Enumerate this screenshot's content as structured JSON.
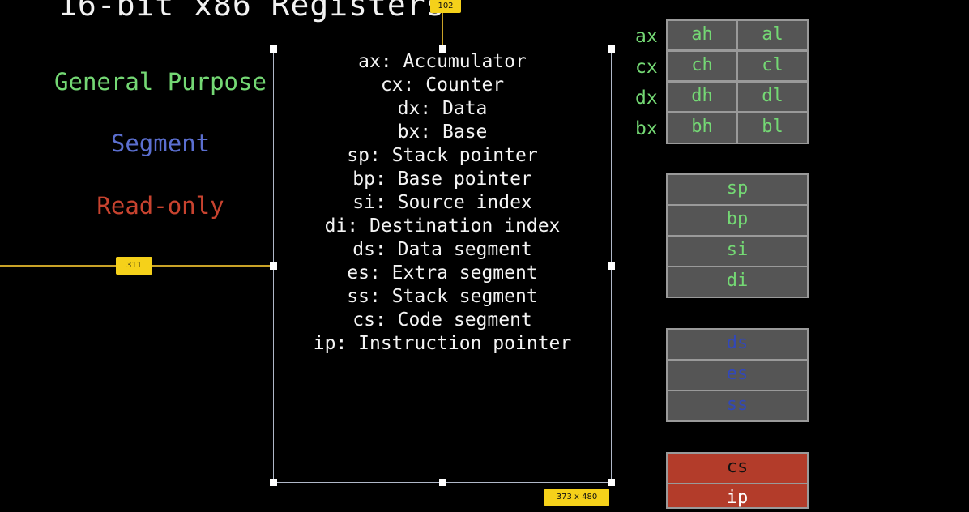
{
  "title": "16-bit x86 Registers",
  "legend": {
    "general_purpose": "General Purpose",
    "segment": "Segment",
    "read_only": "Read-only"
  },
  "annotations": {
    "left_badge": "311",
    "top_badge": "102",
    "size_badge": "373 x 480"
  },
  "descriptions": [
    "ax: Accumulator",
    "cx: Counter",
    "dx: Data",
    "bx: Base",
    "sp: Stack pointer",
    "bp: Base pointer",
    "si: Source index",
    "di: Destination index",
    "ds: Data segment",
    "es: Extra segment",
    "ss: Stack segment",
    "cs: Code segment",
    "ip: Instruction pointer"
  ],
  "gp_registers": [
    {
      "name": "ax",
      "high": "ah",
      "low": "al"
    },
    {
      "name": "cx",
      "high": "ch",
      "low": "cl"
    },
    {
      "name": "dx",
      "high": "dh",
      "low": "dl"
    },
    {
      "name": "bx",
      "high": "bh",
      "low": "bl"
    }
  ],
  "pointer_registers": [
    "sp",
    "bp",
    "si",
    "di"
  ],
  "segment_registers": [
    "ds",
    "es",
    "ss"
  ],
  "readonly_registers": [
    "cs",
    "ip"
  ],
  "colors": {
    "general_purpose": "#74d874",
    "segment": "#3248b8",
    "read_only": "#b33c2a",
    "cell_bg": "#555555",
    "annotation": "#f5d11a"
  }
}
